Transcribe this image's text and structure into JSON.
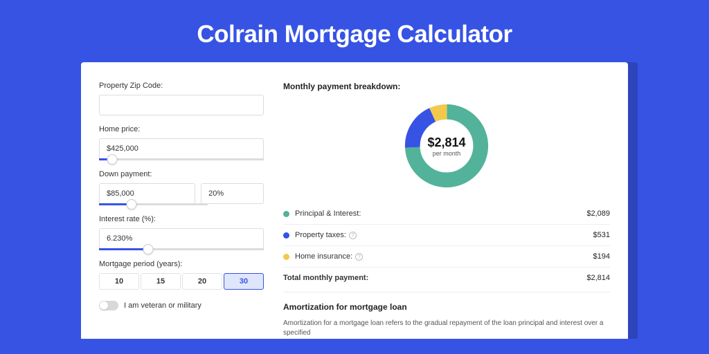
{
  "title": "Colrain Mortgage Calculator",
  "form": {
    "zip_label": "Property Zip Code:",
    "zip_value": "",
    "home_price_label": "Home price:",
    "home_price_value": "$425,000",
    "home_price_slider_pct": 8,
    "down_payment_label": "Down payment:",
    "down_payment_value": "$85,000",
    "down_payment_pct": "20%",
    "down_payment_slider_pct": 20,
    "interest_label": "Interest rate (%):",
    "interest_value": "6.230%",
    "interest_slider_pct": 30,
    "period_label": "Mortgage period (years):",
    "periods": [
      "10",
      "15",
      "20",
      "30"
    ],
    "period_selected": "30",
    "veteran_label": "I am veteran or military"
  },
  "breakdown": {
    "title": "Monthly payment breakdown:",
    "center_amount": "$2,814",
    "center_sub": "per month",
    "items": [
      {
        "color": "green",
        "label": "Principal & Interest:",
        "value": "$2,089",
        "info": false
      },
      {
        "color": "blue",
        "label": "Property taxes:",
        "value": "$531",
        "info": true
      },
      {
        "color": "yellow",
        "label": "Home insurance:",
        "value": "$194",
        "info": true
      }
    ],
    "total_label": "Total monthly payment:",
    "total_value": "$2,814"
  },
  "amortization": {
    "title": "Amortization for mortgage loan",
    "text": "Amortization for a mortgage loan refers to the gradual repayment of the loan principal and interest over a specified"
  },
  "chart_data": {
    "type": "pie",
    "title": "Monthly payment breakdown",
    "series": [
      {
        "name": "Principal & Interest",
        "value": 2089,
        "color": "#52b39a"
      },
      {
        "name": "Property taxes",
        "value": 531,
        "color": "#3753e4"
      },
      {
        "name": "Home insurance",
        "value": 194,
        "color": "#f2c94c"
      }
    ],
    "total": 2814,
    "center_label": "$2,814 per month"
  }
}
